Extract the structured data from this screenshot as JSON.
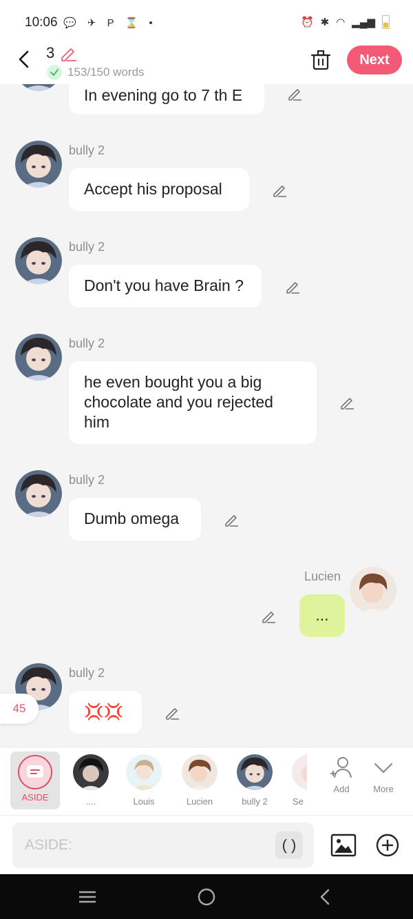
{
  "status_bar": {
    "time": "10:06",
    "left_icons": "💬 ✈ P ⌛ •"
  },
  "header": {
    "title": "3",
    "word_count": "153/150 words",
    "next_label": "Next"
  },
  "messages": [
    {
      "speaker": "",
      "text": "In evening go to 7 th E"
    },
    {
      "speaker": "bully 2",
      "text": "Accept his proposal"
    },
    {
      "speaker": "bully 2",
      "text": "Don't you have Brain ?"
    },
    {
      "speaker": "bully 2",
      "text": "he even bought you a big chocolate and you rejected him"
    },
    {
      "speaker": "bully 2",
      "text": "Dumb omega"
    },
    {
      "speaker": "Lucien",
      "text": "..."
    },
    {
      "speaker": "bully 2",
      "text": "💢💢"
    }
  ],
  "counter": "45",
  "characters": [
    {
      "label": "ASIDE"
    },
    {
      "label": "...."
    },
    {
      "label": "Louis"
    },
    {
      "label": "Lucien"
    },
    {
      "label": "bully 2"
    },
    {
      "label": "Se"
    }
  ],
  "actions": {
    "add_label": "Add",
    "more_label": "More"
  },
  "composer": {
    "placeholder": "ASIDE:",
    "paren_label": "( )"
  },
  "colors": {
    "accent": "#f25a75",
    "user_bubble": "#dff39a",
    "aside_red": "#e24d66"
  }
}
